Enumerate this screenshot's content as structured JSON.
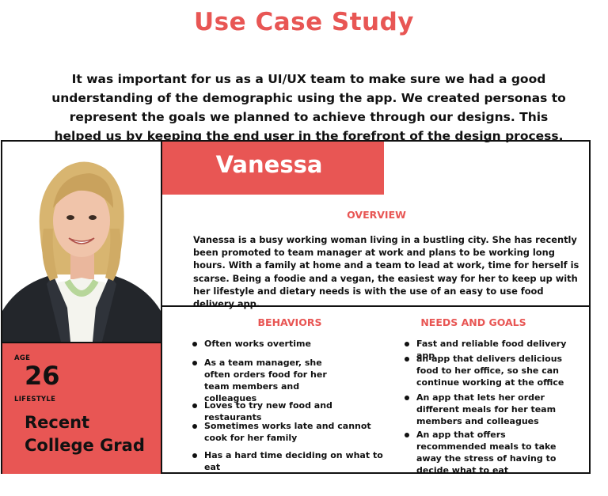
{
  "title": "Use Case Study",
  "intro": "It was important for us as a UI/UX team to make sure we had a good understanding of the demographic using the app.  We created personas to represent the goals we planned to achieve through our designs.  This helped us by keeping the end user in the forefront of the design process.",
  "persona": {
    "name": "Vanessa",
    "age_label": "AGE",
    "age": "26",
    "lifestyle_label": "LIFESTYLE",
    "lifestyle": "Recent College Grad",
    "overview_heading": "OVERVIEW",
    "overview": "Vanessa is a busy working woman living in a bustling city.  She has recently been promoted to team manager at work and plans to be working long hours. With a family at home and a team to lead at work, time for herself is scarse. Being a foodie and a vegan, the easiest way for her to keep up with her lifestyle and dietary needs is with the use of an easy to use food delivery app.",
    "behaviors_heading": "BEHAVIORS",
    "behaviors": [
      "Often works overtime",
      "As a team manager, she often orders food for her team members and colleagues",
      "Loves to try new food and restaurants",
      "Sometimes works late and cannot cook for her family",
      "Has a hard time deciding on what to eat"
    ],
    "needs_heading": "NEEDS AND GOALS",
    "needs": [
      "Fast and reliable food delivery app",
      "an app that delivers delicious food to her office, so she can continue working at the office",
      "An app that lets her order different meals for her team members and colleagues",
      "An app that offers recommended meals to take away the stress of having to decide what to eat"
    ]
  },
  "colors": {
    "accent": "#e85654",
    "text": "#111111"
  },
  "icons": [
    "persona-photo"
  ]
}
